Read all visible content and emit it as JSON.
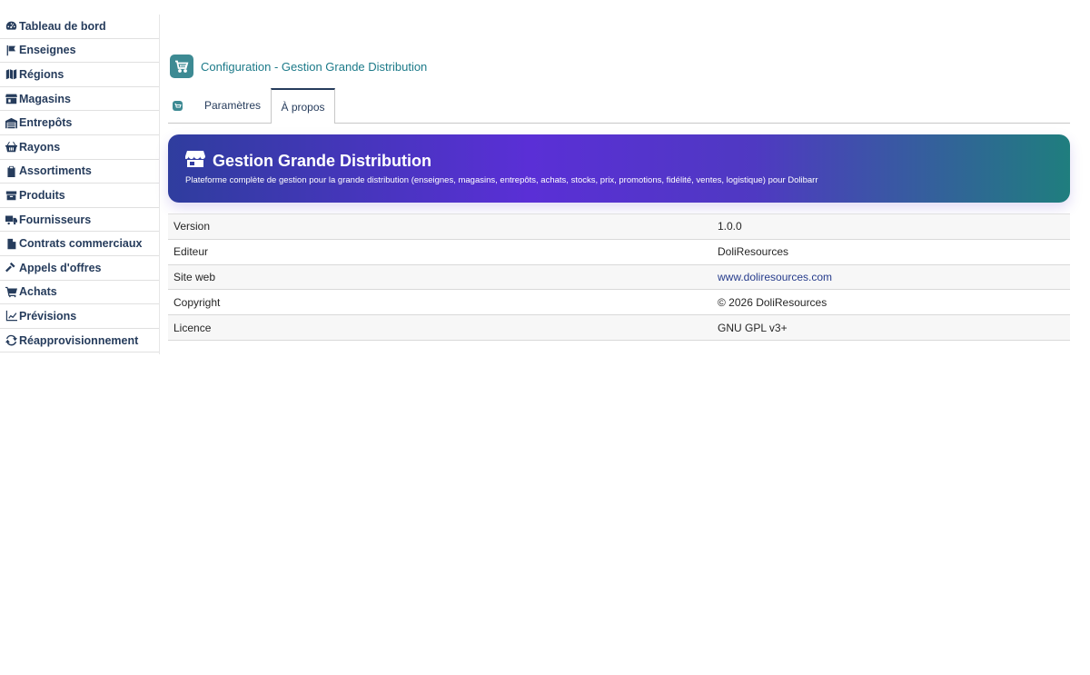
{
  "sidebar": {
    "items": [
      {
        "label": "Tableau de bord",
        "icon": "dashboard-icon"
      },
      {
        "label": "Enseignes",
        "icon": "flag-icon"
      },
      {
        "label": "Régions",
        "icon": "map-icon"
      },
      {
        "label": "Magasins",
        "icon": "store-icon"
      },
      {
        "label": "Entrepôts",
        "icon": "warehouse-icon"
      },
      {
        "label": "Rayons",
        "icon": "basket-icon"
      },
      {
        "label": "Assortiments",
        "icon": "clipboard-icon"
      },
      {
        "label": "Produits",
        "icon": "box-icon"
      },
      {
        "label": "Fournisseurs",
        "icon": "truck-icon"
      },
      {
        "label": "Contrats commerciaux",
        "icon": "document-icon"
      },
      {
        "label": "Appels d'offres",
        "icon": "gavel-icon"
      },
      {
        "label": "Achats",
        "icon": "cart-icon"
      },
      {
        "label": "Prévisions",
        "icon": "chart-line-icon"
      },
      {
        "label": "Réapprovisionnement",
        "icon": "refresh-icon"
      }
    ]
  },
  "header": {
    "title": "Configuration - Gestion Grande Distribution"
  },
  "tabs": [
    {
      "label": "Paramètres",
      "active": false
    },
    {
      "label": "À propos",
      "active": true
    }
  ],
  "banner": {
    "title": "Gestion Grande Distribution",
    "subtitle": "Plateforme complète de gestion pour la grande distribution (enseignes, magasins, entrepôts, achats, stocks, prix, promotions, fidélité, ventes, logistique) pour Dolibarr"
  },
  "info": [
    {
      "key": "Version",
      "value": "1.0.0"
    },
    {
      "key": "Editeur",
      "value": "DoliResources"
    },
    {
      "key": "Site web",
      "value": "www.doliresources.com"
    },
    {
      "key": "Copyright",
      "value": "© 2026 DoliResources"
    },
    {
      "key": "Licence",
      "value": "GNU GPL v3+"
    }
  ],
  "colors": {
    "nav_text": "#263c5c",
    "accent_teal": "#3d8a93",
    "title_teal": "#1c7a89",
    "banner_start": "#2f3d9e",
    "banner_mid": "#5a2fd6",
    "banner_end": "#1f7e7e"
  }
}
